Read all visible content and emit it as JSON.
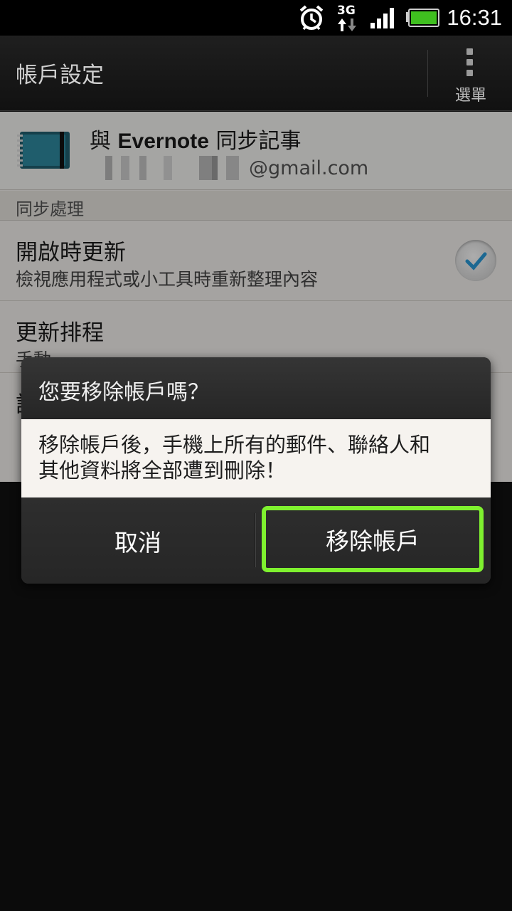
{
  "status_bar": {
    "time": "16:31",
    "network": "3G",
    "icons": [
      "alarm-icon",
      "3g-icon",
      "signal-icon",
      "battery-icon"
    ],
    "battery_color": "#3fbf1f"
  },
  "action_bar": {
    "title": "帳戶設定",
    "menu_label": "選單"
  },
  "account": {
    "title_prefix": "與 ",
    "title_brand": "Evernote",
    "title_suffix": " 同步記事",
    "email_domain": "@gmail.com"
  },
  "section": {
    "label": "同步處理"
  },
  "settings": [
    {
      "title": "開啟時更新",
      "subtitle": "檢視應用程式或小工具時重新整理內容",
      "checked": true
    },
    {
      "title": "更新排程",
      "subtitle": "手動"
    },
    {
      "title": "設",
      "subtitle": ""
    }
  ],
  "dialog": {
    "title": "您要移除帳戶嗎？",
    "message_line1": "移除帳戶後，手機上所有的郵件、聯絡人和",
    "message_line2": "其他資料將全部遭到刪除！",
    "cancel_label": "取消",
    "confirm_label": "移除帳戶",
    "highlight_color": "#7ff12f"
  }
}
